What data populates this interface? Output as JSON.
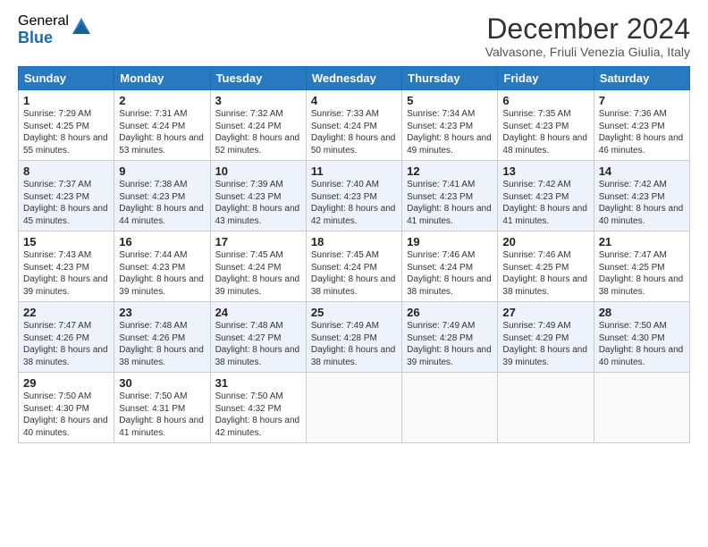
{
  "logo": {
    "general": "General",
    "blue": "Blue"
  },
  "title": "December 2024",
  "subtitle": "Valvasone, Friuli Venezia Giulia, Italy",
  "days_header": [
    "Sunday",
    "Monday",
    "Tuesday",
    "Wednesday",
    "Thursday",
    "Friday",
    "Saturday"
  ],
  "weeks": [
    [
      {
        "day": 1,
        "sunrise": "Sunrise: 7:29 AM",
        "sunset": "Sunset: 4:25 PM",
        "daylight": "Daylight: 8 hours and 55 minutes."
      },
      {
        "day": 2,
        "sunrise": "Sunrise: 7:31 AM",
        "sunset": "Sunset: 4:24 PM",
        "daylight": "Daylight: 8 hours and 53 minutes."
      },
      {
        "day": 3,
        "sunrise": "Sunrise: 7:32 AM",
        "sunset": "Sunset: 4:24 PM",
        "daylight": "Daylight: 8 hours and 52 minutes."
      },
      {
        "day": 4,
        "sunrise": "Sunrise: 7:33 AM",
        "sunset": "Sunset: 4:24 PM",
        "daylight": "Daylight: 8 hours and 50 minutes."
      },
      {
        "day": 5,
        "sunrise": "Sunrise: 7:34 AM",
        "sunset": "Sunset: 4:23 PM",
        "daylight": "Daylight: 8 hours and 49 minutes."
      },
      {
        "day": 6,
        "sunrise": "Sunrise: 7:35 AM",
        "sunset": "Sunset: 4:23 PM",
        "daylight": "Daylight: 8 hours and 48 minutes."
      },
      {
        "day": 7,
        "sunrise": "Sunrise: 7:36 AM",
        "sunset": "Sunset: 4:23 PM",
        "daylight": "Daylight: 8 hours and 46 minutes."
      }
    ],
    [
      {
        "day": 8,
        "sunrise": "Sunrise: 7:37 AM",
        "sunset": "Sunset: 4:23 PM",
        "daylight": "Daylight: 8 hours and 45 minutes."
      },
      {
        "day": 9,
        "sunrise": "Sunrise: 7:38 AM",
        "sunset": "Sunset: 4:23 PM",
        "daylight": "Daylight: 8 hours and 44 minutes."
      },
      {
        "day": 10,
        "sunrise": "Sunrise: 7:39 AM",
        "sunset": "Sunset: 4:23 PM",
        "daylight": "Daylight: 8 hours and 43 minutes."
      },
      {
        "day": 11,
        "sunrise": "Sunrise: 7:40 AM",
        "sunset": "Sunset: 4:23 PM",
        "daylight": "Daylight: 8 hours and 42 minutes."
      },
      {
        "day": 12,
        "sunrise": "Sunrise: 7:41 AM",
        "sunset": "Sunset: 4:23 PM",
        "daylight": "Daylight: 8 hours and 41 minutes."
      },
      {
        "day": 13,
        "sunrise": "Sunrise: 7:42 AM",
        "sunset": "Sunset: 4:23 PM",
        "daylight": "Daylight: 8 hours and 41 minutes."
      },
      {
        "day": 14,
        "sunrise": "Sunrise: 7:42 AM",
        "sunset": "Sunset: 4:23 PM",
        "daylight": "Daylight: 8 hours and 40 minutes."
      }
    ],
    [
      {
        "day": 15,
        "sunrise": "Sunrise: 7:43 AM",
        "sunset": "Sunset: 4:23 PM",
        "daylight": "Daylight: 8 hours and 39 minutes."
      },
      {
        "day": 16,
        "sunrise": "Sunrise: 7:44 AM",
        "sunset": "Sunset: 4:23 PM",
        "daylight": "Daylight: 8 hours and 39 minutes."
      },
      {
        "day": 17,
        "sunrise": "Sunrise: 7:45 AM",
        "sunset": "Sunset: 4:24 PM",
        "daylight": "Daylight: 8 hours and 39 minutes."
      },
      {
        "day": 18,
        "sunrise": "Sunrise: 7:45 AM",
        "sunset": "Sunset: 4:24 PM",
        "daylight": "Daylight: 8 hours and 38 minutes."
      },
      {
        "day": 19,
        "sunrise": "Sunrise: 7:46 AM",
        "sunset": "Sunset: 4:24 PM",
        "daylight": "Daylight: 8 hours and 38 minutes."
      },
      {
        "day": 20,
        "sunrise": "Sunrise: 7:46 AM",
        "sunset": "Sunset: 4:25 PM",
        "daylight": "Daylight: 8 hours and 38 minutes."
      },
      {
        "day": 21,
        "sunrise": "Sunrise: 7:47 AM",
        "sunset": "Sunset: 4:25 PM",
        "daylight": "Daylight: 8 hours and 38 minutes."
      }
    ],
    [
      {
        "day": 22,
        "sunrise": "Sunrise: 7:47 AM",
        "sunset": "Sunset: 4:26 PM",
        "daylight": "Daylight: 8 hours and 38 minutes."
      },
      {
        "day": 23,
        "sunrise": "Sunrise: 7:48 AM",
        "sunset": "Sunset: 4:26 PM",
        "daylight": "Daylight: 8 hours and 38 minutes."
      },
      {
        "day": 24,
        "sunrise": "Sunrise: 7:48 AM",
        "sunset": "Sunset: 4:27 PM",
        "daylight": "Daylight: 8 hours and 38 minutes."
      },
      {
        "day": 25,
        "sunrise": "Sunrise: 7:49 AM",
        "sunset": "Sunset: 4:28 PM",
        "daylight": "Daylight: 8 hours and 38 minutes."
      },
      {
        "day": 26,
        "sunrise": "Sunrise: 7:49 AM",
        "sunset": "Sunset: 4:28 PM",
        "daylight": "Daylight: 8 hours and 39 minutes."
      },
      {
        "day": 27,
        "sunrise": "Sunrise: 7:49 AM",
        "sunset": "Sunset: 4:29 PM",
        "daylight": "Daylight: 8 hours and 39 minutes."
      },
      {
        "day": 28,
        "sunrise": "Sunrise: 7:50 AM",
        "sunset": "Sunset: 4:30 PM",
        "daylight": "Daylight: 8 hours and 40 minutes."
      }
    ],
    [
      {
        "day": 29,
        "sunrise": "Sunrise: 7:50 AM",
        "sunset": "Sunset: 4:30 PM",
        "daylight": "Daylight: 8 hours and 40 minutes."
      },
      {
        "day": 30,
        "sunrise": "Sunrise: 7:50 AM",
        "sunset": "Sunset: 4:31 PM",
        "daylight": "Daylight: 8 hours and 41 minutes."
      },
      {
        "day": 31,
        "sunrise": "Sunrise: 7:50 AM",
        "sunset": "Sunset: 4:32 PM",
        "daylight": "Daylight: 8 hours and 42 minutes."
      },
      null,
      null,
      null,
      null
    ]
  ]
}
